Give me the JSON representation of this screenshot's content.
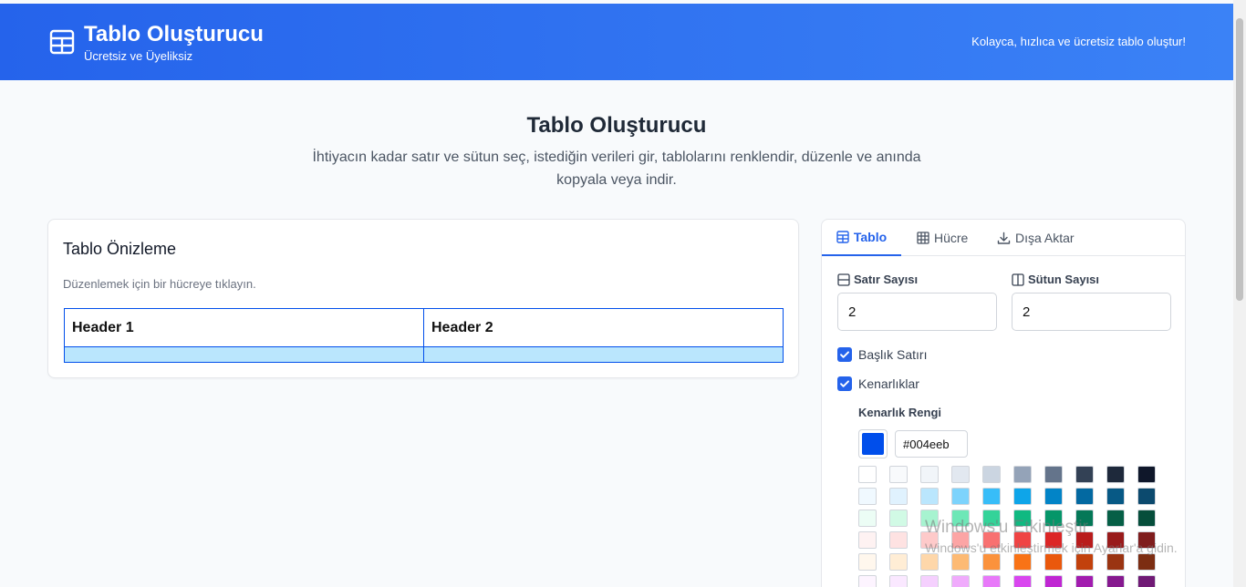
{
  "header": {
    "title": "Tablo Oluşturucu",
    "subtitle": "Ücretsiz ve Üyeliksiz",
    "tagline": "Kolayca, hızlıca ve ücretsiz tablo oluştur!"
  },
  "hero": {
    "title": "Tablo Oluşturucu",
    "description": "İhtiyacın kadar satır ve sütun seç, istediğin verileri gir, tablolarını renklendir, düzenle ve anında kopyala veya indir."
  },
  "preview": {
    "title": "Tablo Önizleme",
    "hint": "Düzenlemek için bir hücreye tıklayın.",
    "headers": [
      "Header 1",
      "Header 2"
    ],
    "rows": [
      [
        "",
        ""
      ]
    ]
  },
  "settings": {
    "tabs": [
      "Tablo",
      "Hücre",
      "Dışa Aktar"
    ],
    "active_tab": "Tablo",
    "row_count_label": "Satır Sayısı",
    "row_count": "2",
    "col_count_label": "Sütun Sayısı",
    "col_count": "2",
    "header_row_label": "Başlık Satırı",
    "header_row_checked": true,
    "borders_label": "Kenarlıklar",
    "borders_checked": true,
    "border_color_label": "Kenarlık Rengi",
    "border_color": "#004eeb",
    "palette": [
      [
        "#ffffff",
        "#f8fafc",
        "#f1f5f9",
        "#e2e8f0",
        "#cbd5e1",
        "#94a3b8",
        "#64748b",
        "#334155",
        "#1e293b",
        "#0f172a"
      ],
      [
        "#f0f9ff",
        "#e0f2fe",
        "#bae6fd",
        "#7dd3fc",
        "#38bdf8",
        "#0ea5e9",
        "#0284c7",
        "#0369a1",
        "#075985",
        "#0c4a6e"
      ],
      [
        "#ecfdf5",
        "#d1fae5",
        "#a7f3d0",
        "#6ee7b7",
        "#34d399",
        "#10b981",
        "#059669",
        "#047857",
        "#065f46",
        "#064e3b"
      ],
      [
        "#fef2f2",
        "#fee2e2",
        "#fecaca",
        "#fca5a5",
        "#f87171",
        "#ef4444",
        "#dc2626",
        "#b91c1c",
        "#991b1b",
        "#7f1d1d"
      ],
      [
        "#fff7ed",
        "#ffedd5",
        "#fed7aa",
        "#fdba74",
        "#fb923c",
        "#f97316",
        "#ea580c",
        "#c2410c",
        "#9a3412",
        "#7c2d12"
      ],
      [
        "#fdf4ff",
        "#fae8ff",
        "#f5d0fe",
        "#f0abfc",
        "#e879f9",
        "#d946ef",
        "#c026d3",
        "#a21caf",
        "#86198f",
        "#701a75"
      ]
    ]
  },
  "watermark": {
    "line1": "Windows'u Etkinleştir",
    "line2": "Windows'u etkinleştirmek için Ayarlar'a gidin."
  }
}
